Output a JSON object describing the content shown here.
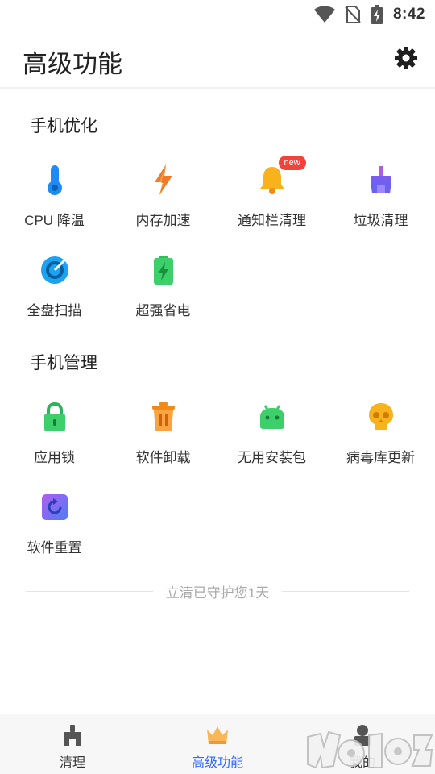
{
  "status": {
    "time": "8:42"
  },
  "header": {
    "title": "高级功能"
  },
  "sections": [
    {
      "title": "手机优化",
      "items": [
        {
          "label": "CPU 降温",
          "icon": "thermometer-icon"
        },
        {
          "label": "内存加速",
          "icon": "lightning-icon"
        },
        {
          "label": "通知栏清理",
          "icon": "bell-icon",
          "badge": "new"
        },
        {
          "label": "垃圾清理",
          "icon": "broom-icon"
        },
        {
          "label": "全盘扫描",
          "icon": "scan-icon"
        },
        {
          "label": "超强省电",
          "icon": "battery-icon"
        }
      ]
    },
    {
      "title": "手机管理",
      "items": [
        {
          "label": "应用锁",
          "icon": "lock-icon"
        },
        {
          "label": "软件卸载",
          "icon": "trash-icon"
        },
        {
          "label": "无用安装包",
          "icon": "android-icon"
        },
        {
          "label": "病毒库更新",
          "icon": "skull-icon"
        },
        {
          "label": "软件重置",
          "icon": "reset-icon"
        }
      ]
    }
  ],
  "footer_note": "立清已守护您1天",
  "nav": [
    {
      "label": "清理",
      "icon": "broom-icon",
      "active": false
    },
    {
      "label": "高级功能",
      "icon": "crown-icon",
      "active": true
    },
    {
      "label": "我的",
      "icon": "profile-icon",
      "active": false
    }
  ],
  "colors": {
    "accent": "#2f6bff",
    "badge": "#f0443a"
  }
}
